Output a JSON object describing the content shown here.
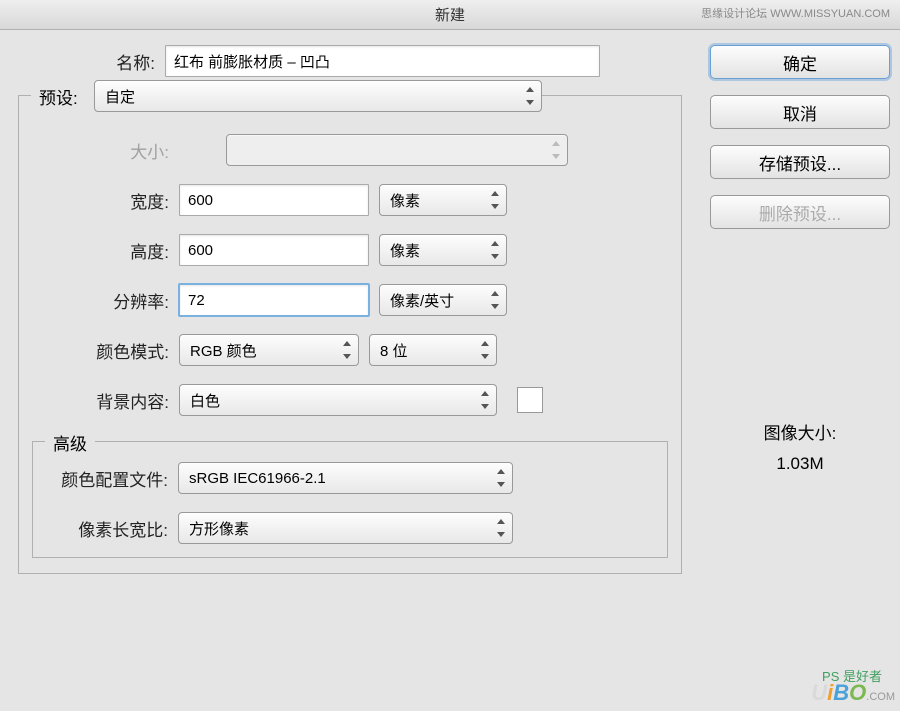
{
  "titlebar": {
    "title": "新建",
    "watermark": "思缘设计论坛  WWW.MISSYUAN.COM"
  },
  "name": {
    "label": "名称:",
    "value": "红布 前膨胀材质 – 凹凸"
  },
  "preset": {
    "legend": "预设:",
    "value": "自定"
  },
  "size": {
    "label": "大小:",
    "value": ""
  },
  "width": {
    "label": "宽度:",
    "value": "600",
    "unit": "像素"
  },
  "height": {
    "label": "高度:",
    "value": "600",
    "unit": "像素"
  },
  "resolution": {
    "label": "分辨率:",
    "value": "72",
    "unit": "像素/英寸"
  },
  "colormode": {
    "label": "颜色模式:",
    "value": "RGB 颜色",
    "bits": "8 位"
  },
  "background": {
    "label": "背景内容:",
    "value": "白色"
  },
  "advanced": {
    "legend": "高级",
    "profile_label": "颜色配置文件:",
    "profile_value": "sRGB IEC61966-2.1",
    "aspect_label": "像素长宽比:",
    "aspect_value": "方形像素"
  },
  "buttons": {
    "ok": "确定",
    "cancel": "取消",
    "save_preset": "存储预设...",
    "delete_preset": "删除预设..."
  },
  "image_size": {
    "label": "图像大小:",
    "value": "1.03M"
  },
  "watermark_bottom": {
    "text": "UiBO",
    "cn": "PS 是好者",
    "com": ".COM"
  }
}
